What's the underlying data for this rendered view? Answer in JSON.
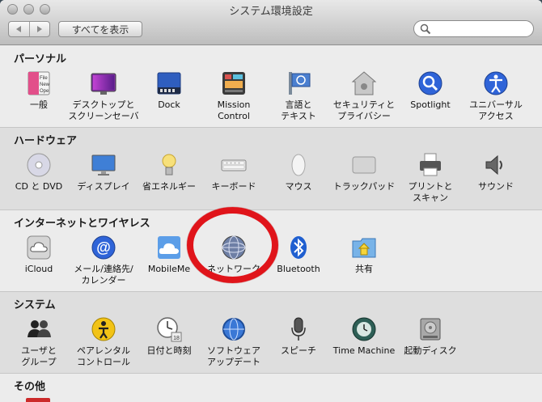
{
  "window": {
    "title": "システム環境設定"
  },
  "toolbar": {
    "show_all": "すべてを表示",
    "search_placeholder": ""
  },
  "sections": [
    {
      "title": "パーソナル",
      "items": [
        {
          "label": "一般",
          "icon": "general-icon"
        },
        {
          "label": "デスクトップと\nスクリーンセーバ",
          "icon": "desktop-icon"
        },
        {
          "label": "Dock",
          "icon": "dock-icon"
        },
        {
          "label": "Mission\nControl",
          "icon": "mission-control-icon"
        },
        {
          "label": "言語と\nテキスト",
          "icon": "language-icon"
        },
        {
          "label": "セキュリティと\nプライバシー",
          "icon": "security-icon"
        },
        {
          "label": "Spotlight",
          "icon": "spotlight-icon"
        },
        {
          "label": "ユニバーサル\nアクセス",
          "icon": "universal-access-icon"
        }
      ]
    },
    {
      "title": "ハードウェア",
      "items": [
        {
          "label": "CD と DVD",
          "icon": "cd-dvd-icon"
        },
        {
          "label": "ディスプレイ",
          "icon": "display-icon"
        },
        {
          "label": "省エネルギー",
          "icon": "energy-saver-icon"
        },
        {
          "label": "キーボード",
          "icon": "keyboard-icon"
        },
        {
          "label": "マウス",
          "icon": "mouse-icon"
        },
        {
          "label": "トラックパッド",
          "icon": "trackpad-icon"
        },
        {
          "label": "プリントと\nスキャン",
          "icon": "print-scan-icon"
        },
        {
          "label": "サウンド",
          "icon": "sound-icon"
        }
      ]
    },
    {
      "title": "インターネットとワイヤレス",
      "items": [
        {
          "label": "iCloud",
          "icon": "icloud-icon"
        },
        {
          "label": "メール/連絡先/\nカレンダー",
          "icon": "mail-contacts-icon"
        },
        {
          "label": "MobileMe",
          "icon": "mobileme-icon"
        },
        {
          "label": "ネットワーク",
          "icon": "network-icon"
        },
        {
          "label": "Bluetooth",
          "icon": "bluetooth-icon"
        },
        {
          "label": "共有",
          "icon": "sharing-icon"
        }
      ]
    },
    {
      "title": "システム",
      "items": [
        {
          "label": "ユーザと\nグループ",
          "icon": "users-icon"
        },
        {
          "label": "ペアレンタル\nコントロール",
          "icon": "parental-controls-icon"
        },
        {
          "label": "日付と時刻",
          "icon": "date-time-icon"
        },
        {
          "label": "ソフトウェア\nアップデート",
          "icon": "software-update-icon"
        },
        {
          "label": "スピーチ",
          "icon": "speech-icon"
        },
        {
          "label": "Time Machine",
          "icon": "time-machine-icon"
        },
        {
          "label": "起動ディスク",
          "icon": "startup-disk-icon"
        }
      ]
    },
    {
      "title": "その他",
      "items": []
    }
  ]
}
